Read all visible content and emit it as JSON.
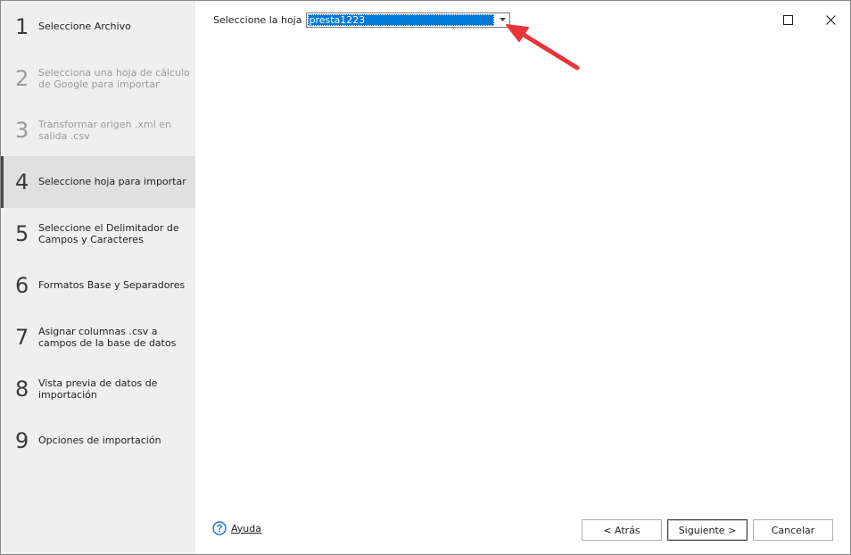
{
  "steps": [
    {
      "number": "1",
      "label": "Seleccione Archivo",
      "state": "normal"
    },
    {
      "number": "2",
      "label": "Selecciona una hoja de cálculo de Google para importar",
      "state": "disabled"
    },
    {
      "number": "3",
      "label": "Transformar origen .xml en salida .csv",
      "state": "disabled"
    },
    {
      "number": "4",
      "label": "Seleccione hoja para importar",
      "state": "active"
    },
    {
      "number": "5",
      "label": "Seleccione el Delimitador de Campos y Caracteres",
      "state": "normal"
    },
    {
      "number": "6",
      "label": "Formatos Base y Separadores",
      "state": "normal"
    },
    {
      "number": "7",
      "label": "Asignar columnas .csv a campos de la base de datos",
      "state": "normal"
    },
    {
      "number": "8",
      "label": "Vista previa de datos de importación",
      "state": "normal"
    },
    {
      "number": "9",
      "label": "Opciones de importación",
      "state": "normal"
    }
  ],
  "sheet": {
    "label": "Seleccione la hoja",
    "value": "presta1223"
  },
  "footer": {
    "help": "Ayuda",
    "back": "< Atrás",
    "next": "Siguiente >",
    "cancel": "Cancelar"
  },
  "colors": {
    "selection": "#0078d7",
    "annotation_arrow": "#e8343a",
    "sidebar_bg": "#efefef",
    "active_step_bg": "#e0e0e0",
    "help_icon": "#1f6fcf"
  },
  "icons": {
    "maximize": "maximize-icon",
    "close": "close-icon",
    "dropdown": "chevron-down-icon",
    "help": "help-icon",
    "annotation": "red-arrow-annotation"
  }
}
